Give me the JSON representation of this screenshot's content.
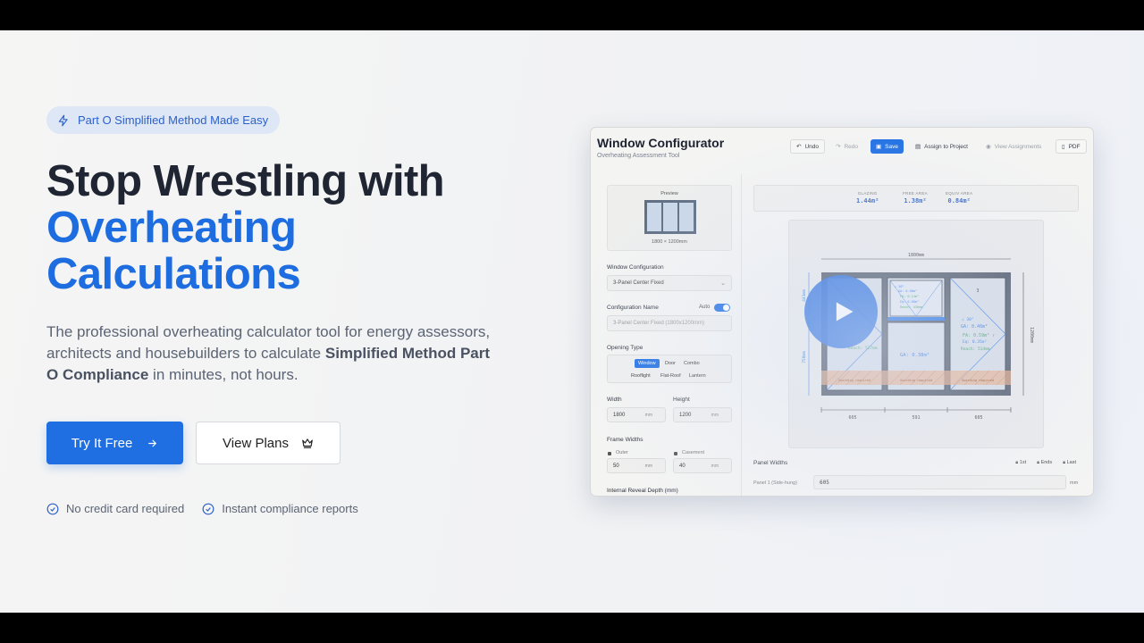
{
  "hero": {
    "badge": "Part O Simplified Method Made Easy",
    "headline_line1": "Stop Wrestling with",
    "headline_line2": "Overheating",
    "headline_line3": "Calculations",
    "sub_pre": "The professional overheating calculator tool for energy assessors, architects and housebuilders to calculate ",
    "sub_bold": "Simplified Method Part O Compliance",
    "sub_post": " in minutes, not hours.",
    "cta_primary": "Try It Free",
    "cta_secondary": "View Plans",
    "check1": "No credit card required",
    "check2": "Instant compliance reports"
  },
  "app": {
    "title": "Window Configurator",
    "subtitle": "Overheating Assessment Tool",
    "toolbar": {
      "undo": "Undo",
      "redo": "Redo",
      "save": "Save",
      "assign": "Assign to Project",
      "view": "View Assignments",
      "pdf": "PDF"
    },
    "left": {
      "preview_label": "Preview",
      "preview_dim": "1800 × 1200mm",
      "window_config_label": "Window Configuration",
      "window_config_value": "3-Panel Center Fixed",
      "config_name_label": "Configuration Name",
      "auto_label": "Auto",
      "config_name_placeholder": "3-Panel Center Fixed (1800x1200mm)",
      "opening_type_label": "Opening Type",
      "opening_types": [
        "Window",
        "Door",
        "Combo",
        "Rooflight",
        "Flat-Roof",
        "Lantern"
      ],
      "width_label": "Width",
      "height_label": "Height",
      "width_value": "1800",
      "height_value": "1200",
      "unit_mm": "mm",
      "frame_widths_label": "Frame Widths",
      "outer_label": "Outer",
      "casement_label": "Casement",
      "outer_value": "50",
      "casement_value": "40",
      "reveal_label": "Internal Reveal Depth (mm)"
    },
    "stats": {
      "glazing_k": "GLAZING",
      "glazing_v": "1.44m²",
      "free_k": "FREE AREA",
      "free_v": "1.38m²",
      "equiv_k": "EQUIV AREA",
      "equiv_v": "0.84m²"
    },
    "drawing": {
      "top_dim": "1800mm",
      "right_dim": "1200mm",
      "left_dim_top": "443mm",
      "left_dim_bottom": "758mm",
      "bottom_dims": [
        "605",
        "591",
        "605"
      ],
      "panel3_num": "3",
      "p3_angle": "∠ 30°",
      "p3_ga": "GA: 0.46m²",
      "p3_fa": "FA: 0.59m² ↑",
      "p3_eq": "Eq: 0.35m²",
      "p3_reach": "Reach: 514mm",
      "p1_reach": "Reach: 517mm",
      "center_ga": "GA: 0.38m²",
      "top_ga": "GA: 0.08m²",
      "top_fa": "FA: 0.14m²",
      "top_eq": "Eq: 0.08m²",
      "top_reach": "Reach: 430mm",
      "top_angle": "∠ 30°",
      "sill_label": "Guarding required"
    },
    "panel_widths": {
      "label": "Panel Widths",
      "opt1": "1st",
      "opt2": "Ends",
      "opt3": "Last",
      "row_label": "Panel 1 (Side-hung)",
      "row_value": "605",
      "unit": "mm"
    }
  },
  "colors": {
    "accent": "#1f6fe3",
    "heading": "#1f2532",
    "heading_blue": "#1d6de0"
  }
}
